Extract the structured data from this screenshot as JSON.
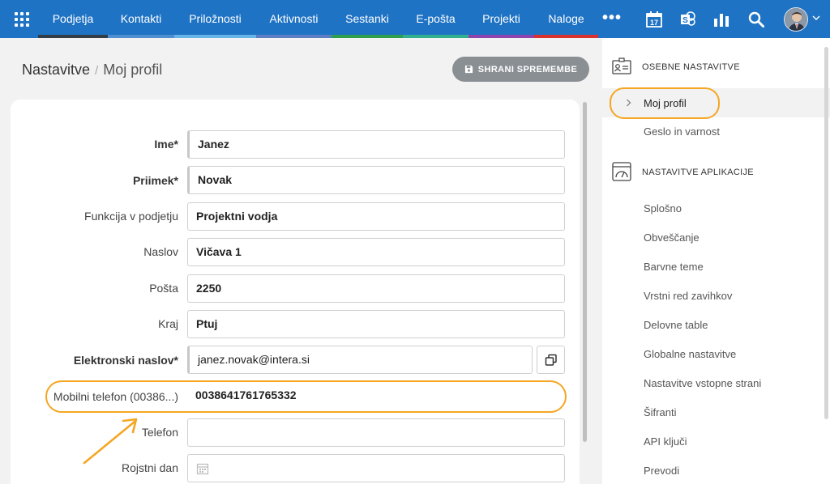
{
  "nav": {
    "items": [
      {
        "label": "Podjetja",
        "bar": "#333d48"
      },
      {
        "label": "Kontakti",
        "bar": "#4d8fd1"
      },
      {
        "label": "Priložnosti",
        "bar": "#67b4e8"
      },
      {
        "label": "Aktivnosti",
        "bar": "#5b7fc2"
      },
      {
        "label": "Sestanki",
        "bar": "#2e9e4f"
      },
      {
        "label": "E-pošta",
        "bar": "#31b08f"
      },
      {
        "label": "Projekti",
        "bar": "#8e44ad"
      },
      {
        "label": "Naloge",
        "bar": "#d9322e"
      }
    ],
    "more_label": "•••",
    "calendar_day": "17",
    "icons": [
      "apps-grid-icon",
      "calendar-icon",
      "sharepoint-icon",
      "chart-bars-icon",
      "search-icon",
      "user-avatar",
      "chevron-down-icon"
    ]
  },
  "header": {
    "breadcrumb_root": "Nastavitve",
    "breadcrumb_sep": "/",
    "breadcrumb_current": "Moj profil",
    "save_label": "SHRANI SPREMEMBE"
  },
  "form": {
    "fields": [
      {
        "label": "Ime*",
        "value": "Janez",
        "required": true
      },
      {
        "label": "Priimek*",
        "value": "Novak",
        "required": true
      },
      {
        "label": "Funkcija v podjetju",
        "value": "Projektni vodja",
        "required": false
      },
      {
        "label": "Naslov",
        "value": "Vičava 1",
        "required": false
      },
      {
        "label": "Pošta",
        "value": "2250",
        "required": false
      },
      {
        "label": "Kraj",
        "value": "Ptuj",
        "required": false
      },
      {
        "label": "Elektronski naslov*",
        "value": "janez.novak@intera.si",
        "required": true
      },
      {
        "label": "Mobilni telefon (00386...)",
        "value": "0038641761765332",
        "required": false
      },
      {
        "label": "Telefon",
        "value": "",
        "required": false
      },
      {
        "label": "Rojstni dan",
        "value": "",
        "required": false
      }
    ]
  },
  "sidebar": {
    "personal_heading": "OSEBNE NASTAVITVE",
    "personal_items": [
      "Moj profil",
      "Geslo in varnost"
    ],
    "app_heading": "NASTAVITVE APLIKACIJE",
    "app_items": [
      "Splošno",
      "Obveščanje",
      "Barvne teme",
      "Vrstni red zavihkov",
      "Delovne table",
      "Globalne nastavitve",
      "Nastavitve vstopne strani",
      "Šifranti",
      "API ključi",
      "Prevodi"
    ]
  },
  "colors": {
    "topbar": "#1f73c4",
    "highlight": "#f5a623",
    "save_button": "#8a8f94"
  }
}
